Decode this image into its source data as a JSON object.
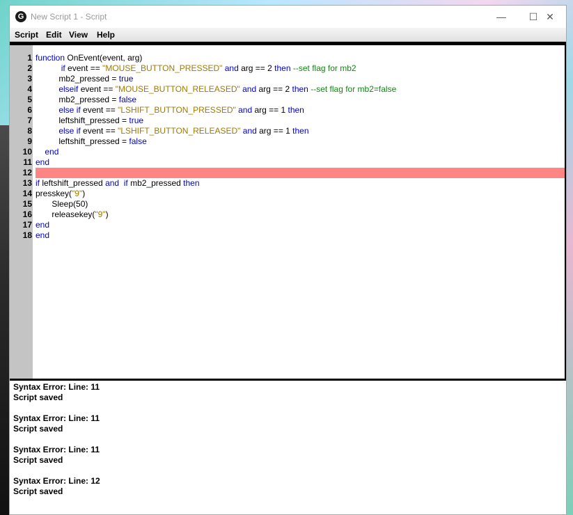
{
  "window": {
    "title": "New Script 1 - Script",
    "logo_glyph": "G",
    "minimize_glyph": "—",
    "maximize_glyph": "☐",
    "close_glyph": "✕"
  },
  "menu": [
    "Script",
    "Edit",
    "View",
    "Help"
  ],
  "editor": {
    "highlight_color": "#ff8585",
    "highlighted_line": 12,
    "lines": [
      {
        "n": "1",
        "code": [
          [
            "kw",
            "function"
          ],
          [
            "t",
            " OnEvent(event, arg)"
          ]
        ]
      },
      {
        "n": "2",
        "code": [
          [
            "t",
            "           "
          ],
          [
            "kw",
            "if"
          ],
          [
            "t",
            " event == "
          ],
          [
            "str",
            "\"MOUSE_BUTTON_PRESSED\""
          ],
          [
            "t",
            " "
          ],
          [
            "kw",
            "and"
          ],
          [
            "t",
            " arg == 2 "
          ],
          [
            "kw",
            "then"
          ],
          [
            "t",
            " "
          ],
          [
            "cm",
            "--set flag for mb2"
          ]
        ]
      },
      {
        "n": "3",
        "code": [
          [
            "t",
            "          mb2_pressed = "
          ],
          [
            "kw",
            "true"
          ]
        ]
      },
      {
        "n": "4",
        "code": [
          [
            "t",
            "          "
          ],
          [
            "kw",
            "elseif"
          ],
          [
            "t",
            " event == "
          ],
          [
            "str",
            "\"MOUSE_BUTTON_RELEASED\""
          ],
          [
            "t",
            " "
          ],
          [
            "kw",
            "and"
          ],
          [
            "t",
            " arg == 2 "
          ],
          [
            "kw",
            "then"
          ],
          [
            "t",
            " "
          ],
          [
            "cm",
            "--set flag for mb2=false"
          ]
        ]
      },
      {
        "n": "5",
        "code": [
          [
            "t",
            "          mb2_pressed = "
          ],
          [
            "kw",
            "false"
          ]
        ]
      },
      {
        "n": "6",
        "code": [
          [
            "t",
            "          "
          ],
          [
            "kw",
            "else if"
          ],
          [
            "t",
            " event == "
          ],
          [
            "str",
            "\"LSHIFT_BUTTON_PRESSED\""
          ],
          [
            "t",
            " "
          ],
          [
            "kw",
            "and"
          ],
          [
            "t",
            " arg == 1 "
          ],
          [
            "kw",
            "then"
          ]
        ]
      },
      {
        "n": "7",
        "code": [
          [
            "t",
            "          leftshift_pressed = "
          ],
          [
            "kw",
            "true"
          ]
        ]
      },
      {
        "n": "8",
        "code": [
          [
            "t",
            "          "
          ],
          [
            "kw",
            "else if"
          ],
          [
            "t",
            " event == "
          ],
          [
            "str",
            "\"LSHIFT_BUTTON_RELEASED\""
          ],
          [
            "t",
            " "
          ],
          [
            "kw",
            "and"
          ],
          [
            "t",
            " arg == 1 "
          ],
          [
            "kw",
            "then"
          ]
        ]
      },
      {
        "n": "9",
        "code": [
          [
            "t",
            "          leftshift_pressed = "
          ],
          [
            "kw",
            "false"
          ]
        ]
      },
      {
        "n": "10",
        "code": [
          [
            "t",
            "    "
          ],
          [
            "kw",
            "end"
          ]
        ]
      },
      {
        "n": "11",
        "code": [
          [
            "kw",
            "end"
          ]
        ]
      },
      {
        "n": "12",
        "code": []
      },
      {
        "n": "13",
        "code": [
          [
            "kw",
            "if"
          ],
          [
            "t",
            " leftshift_pressed "
          ],
          [
            "kw",
            "and"
          ],
          [
            "t",
            "  "
          ],
          [
            "kw",
            "if"
          ],
          [
            "t",
            " mb2_pressed "
          ],
          [
            "kw",
            "then"
          ]
        ]
      },
      {
        "n": "14",
        "code": [
          [
            "t",
            "presskey("
          ],
          [
            "str",
            "\"9\""
          ],
          [
            "t",
            ")"
          ]
        ]
      },
      {
        "n": "15",
        "code": [
          [
            "t",
            "       Sleep(50)"
          ]
        ]
      },
      {
        "n": "16",
        "code": [
          [
            "t",
            "       releasekey("
          ],
          [
            "str",
            "\"9\""
          ],
          [
            "t",
            ")"
          ]
        ]
      },
      {
        "n": "17",
        "code": [
          [
            "kw",
            "end"
          ]
        ]
      },
      {
        "n": "18",
        "code": [
          [
            "kw",
            "end"
          ]
        ]
      }
    ]
  },
  "output": [
    "Syntax Error: Line: 11",
    "Script saved",
    "",
    "Syntax Error: Line: 11",
    "Script saved",
    "",
    "Syntax Error: Line: 11",
    "Script saved",
    "",
    "Syntax Error: Line: 12",
    "Script saved"
  ]
}
